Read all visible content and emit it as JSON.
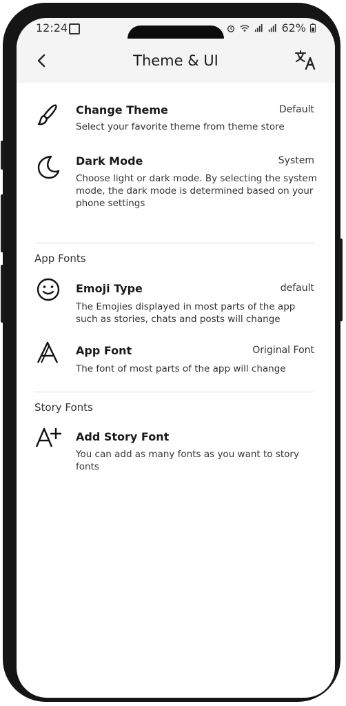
{
  "status": {
    "time": "12:24",
    "battery": "62%"
  },
  "header": {
    "title": "Theme & UI"
  },
  "items": [
    {
      "label": "Change Theme",
      "value": "Default",
      "desc": "Select your favorite theme from theme store",
      "icon": "brush-icon"
    },
    {
      "label": "Dark Mode",
      "value": "System",
      "desc": "Choose light or dark mode. By selecting the system mode, the dark mode is determined based on your phone settings",
      "icon": "moon-icon"
    }
  ],
  "sections": {
    "app_fonts": "App Fonts",
    "story_fonts": "Story Fonts"
  },
  "font_items": [
    {
      "label": "Emoji Type",
      "value": "default",
      "desc": "The Emojies displayed in most parts of the app such as stories, chats and posts will change",
      "icon": "smiley-icon"
    },
    {
      "label": "App Font",
      "value": "Original Font",
      "desc": "The font of most parts of the app will change",
      "icon": "font-a-icon"
    }
  ],
  "story_items": [
    {
      "label": "Add Story Font",
      "desc": "You can add as many fonts as you want to story fonts",
      "icon": "add-font-icon"
    }
  ]
}
